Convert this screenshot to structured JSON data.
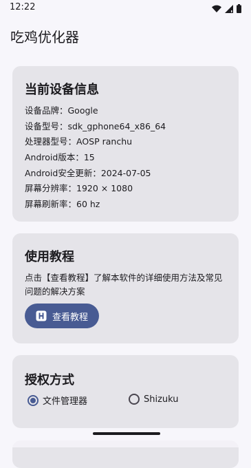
{
  "status": {
    "time": "12:22",
    "icons": [
      "wifi-icon",
      "signal-icon",
      "battery-icon"
    ]
  },
  "app": {
    "title": "吃鸡优化器"
  },
  "device_info": {
    "title": "当前设备信息",
    "rows": [
      "设备品牌：Google",
      "设备型号：sdk_gphone64_x86_64",
      "处理器型号：AOSP ranchu",
      "Android版本：15",
      "Android安全更新：2024-07-05",
      "屏幕分辨率：1920 × 1080",
      "屏幕刷新率：60 hz"
    ]
  },
  "tutorial": {
    "title": "使用教程",
    "description": "点击【查看教程】了解本软件的详细使用方法及常见问题的解决方案",
    "button_label": "查看教程",
    "button_icon": "h-icon"
  },
  "auth": {
    "title": "授权方式",
    "options": [
      {
        "label": "文件管理器",
        "selected": true
      },
      {
        "label": "Shizuku",
        "selected": false
      }
    ]
  },
  "colors": {
    "accent": "#485b93",
    "card_bg": "#e5e4e9",
    "page_bg": "#f7f6fb",
    "text": "#1c1b1f"
  }
}
